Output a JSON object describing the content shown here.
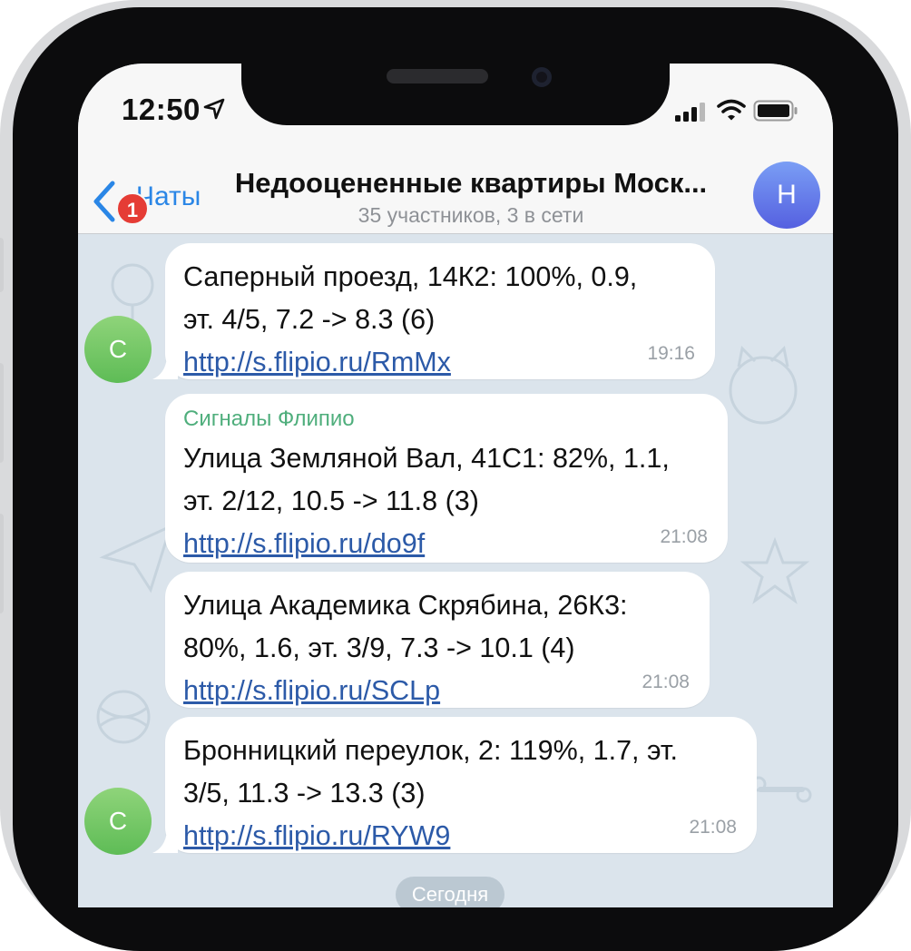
{
  "status_bar": {
    "time": "12:50",
    "icons": [
      "location-arrow-icon",
      "cellular-signal-icon",
      "wifi-icon",
      "battery-icon"
    ]
  },
  "navbar": {
    "back_label": "Чаты",
    "back_badge": "1",
    "title": "Недооцененные квартиры Моск...",
    "subtitle": "35 участников, 3 в сети",
    "avatar_letter": "Н"
  },
  "messages": [
    {
      "sender": "",
      "text": "Саперный проезд, 14К2: 100%, 0.9,\nэт. 4/5, 7.2 -> 8.3 (6)",
      "link": "http://s.flipio.ru/RmMx",
      "time": "19:16",
      "avatar_letter": "С"
    },
    {
      "sender": "Сигналы Флипио",
      "text": "Улица Земляной Вал, 41С1: 82%, 1.1,\nэт. 2/12, 10.5 -> 11.8 (3)",
      "link": "http://s.flipio.ru/do9f",
      "time": "21:08"
    },
    {
      "sender": "",
      "text": "Улица Академика Скрябина, 26К3:\n80%, 1.6, эт. 3/9, 7.3 -> 10.1 (4)",
      "link": "http://s.flipio.ru/SCLp",
      "time": "21:08"
    },
    {
      "sender": "",
      "text": "Бронницкий переулок, 2: 119%, 1.7, эт.\n3/5, 11.3 -> 13.3 (3)",
      "link": "http://s.flipio.ru/RYW9",
      "time": "21:08",
      "avatar_letter": "С"
    }
  ],
  "date_divider": "Сегодня",
  "colors": {
    "accent": "#2a86e6",
    "sender_name": "#4fae7c",
    "link": "#2c5aa8",
    "badge": "#e53c35",
    "chat_background": "#dbe4ec"
  }
}
